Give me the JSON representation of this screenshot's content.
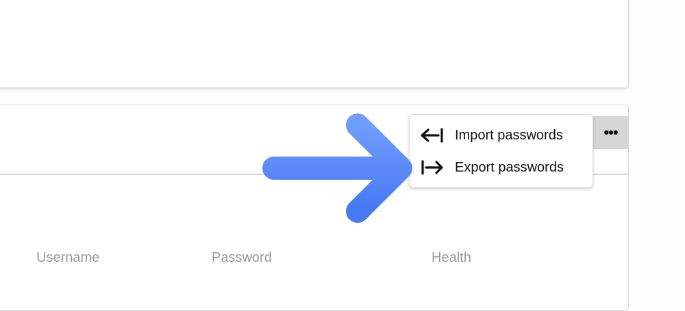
{
  "menu": {
    "items": [
      {
        "label": "Import passwords",
        "icon": "import-arrow-icon"
      },
      {
        "label": "Export passwords",
        "icon": "export-arrow-icon"
      }
    ]
  },
  "more_button": {
    "label": "•••"
  },
  "table": {
    "columns": [
      "Username",
      "Password",
      "Health"
    ]
  },
  "annotation": {
    "arrow_colors": [
      "#6f9dfb",
      "#4778f5"
    ]
  }
}
